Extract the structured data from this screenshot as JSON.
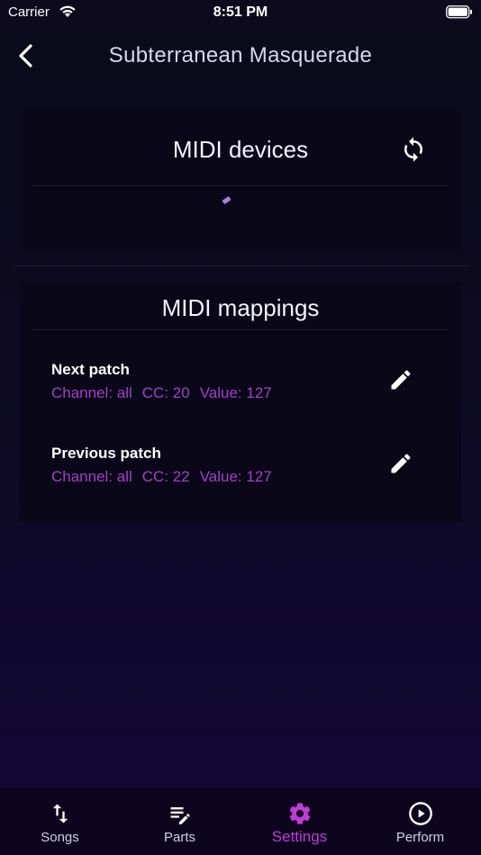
{
  "status_bar": {
    "carrier": "Carrier",
    "time": "8:51 PM"
  },
  "nav": {
    "title": "Subterranean Masquerade"
  },
  "devices": {
    "title": "MIDI devices"
  },
  "mappings": {
    "title": "MIDI mappings",
    "items": [
      {
        "name": "Next patch",
        "channel": "Channel: all",
        "cc": "CC: 20",
        "value": "Value: 127"
      },
      {
        "name": "Previous patch",
        "channel": "Channel: all",
        "cc": "CC: 22",
        "value": "Value: 127"
      }
    ]
  },
  "tabs": [
    {
      "label": "Songs",
      "icon": "swap-vertical-icon"
    },
    {
      "label": "Parts",
      "icon": "playlist-edit-icon"
    },
    {
      "label": "Settings",
      "icon": "gear-icon",
      "active": true
    },
    {
      "label": "Perform",
      "icon": "play-circle-icon"
    }
  ],
  "colors": {
    "accent": "#c23ad8",
    "detail_text": "#a33fc8",
    "card_bg": "#090718"
  }
}
